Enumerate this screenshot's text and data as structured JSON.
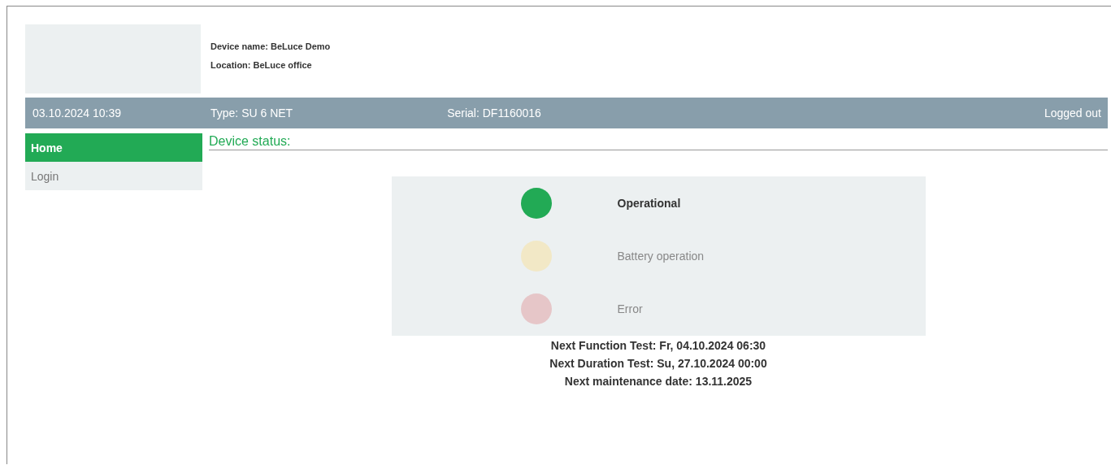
{
  "device": {
    "name": "Device name: BeLuce Demo",
    "location": "Location: BeLuce office"
  },
  "info_bar": {
    "datetime": "03.10.2024 10:39",
    "type": "Type: SU 6 NET",
    "serial": "Serial: DF1160016",
    "login_state": "Logged out"
  },
  "sidebar": {
    "items": [
      {
        "label": "Home",
        "selected": true
      },
      {
        "label": "Login",
        "selected": false
      }
    ]
  },
  "section_title": "Device status:",
  "status_lights": [
    {
      "label": "Operational",
      "active": true,
      "color": "#22aa55"
    },
    {
      "label": "Battery operation",
      "active": false,
      "color": "#f2e8c6"
    },
    {
      "label": "Error",
      "active": false,
      "color": "#e6c6c8"
    }
  ],
  "schedule": [
    "Next Function Test: Fr, 04.10.2024 06:30",
    "Next Duration Test: Su, 27.10.2024 00:00",
    "Next maintenance date: 13.11.2025"
  ]
}
